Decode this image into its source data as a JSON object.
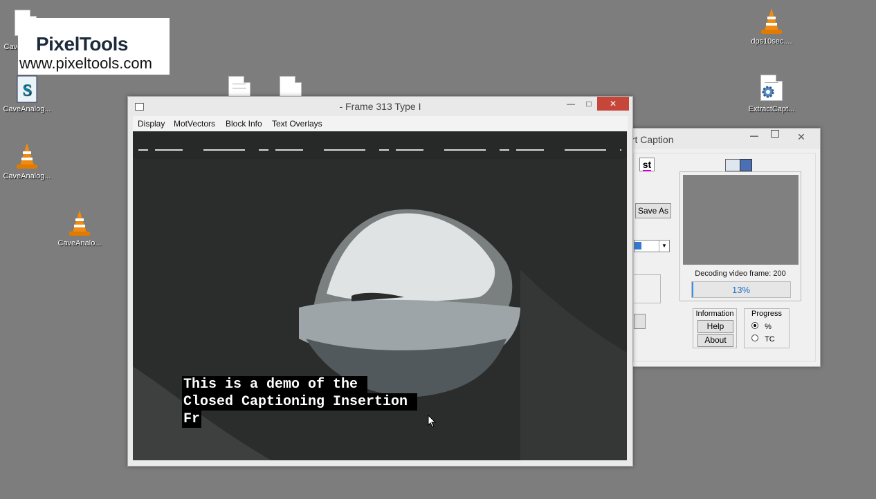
{
  "desktop": {
    "icons": [
      {
        "label": "CaveAnalo..."
      },
      {
        "label": "CaveAnalog..."
      },
      {
        "label": "CaveAnalog..."
      },
      {
        "label": "CaveAnalo..."
      },
      {
        "label": "dps10sec...."
      },
      {
        "label": "ExtractCapt..."
      }
    ]
  },
  "logo": {
    "name": "PixelTools",
    "url": "www.pixeltools.com"
  },
  "player": {
    "title": "- Frame 313  Type I",
    "menu": [
      "Display",
      "MotVectors",
      "Block Info",
      "Text Overlays"
    ],
    "captions": [
      "This is a demo of the ",
      "Closed Captioning Insertion ",
      "Fr"
    ]
  },
  "caption_tool": {
    "title": "ert Caption",
    "st_label": "st",
    "save_as": "Save As",
    "decoding_text": "Decoding video frame: 200",
    "progress_percent": 13,
    "progress_text": "13%",
    "information_label": "Information",
    "help_label": "Help",
    "about_label": "About",
    "progress_label": "Progress",
    "radio_percent": "%",
    "radio_tc": "TC"
  },
  "colors": {
    "desktop": "#7d7d7d",
    "close": "#c7463a",
    "progress_fill": "#3a8ee6",
    "progress_text": "#1e6fc4"
  }
}
